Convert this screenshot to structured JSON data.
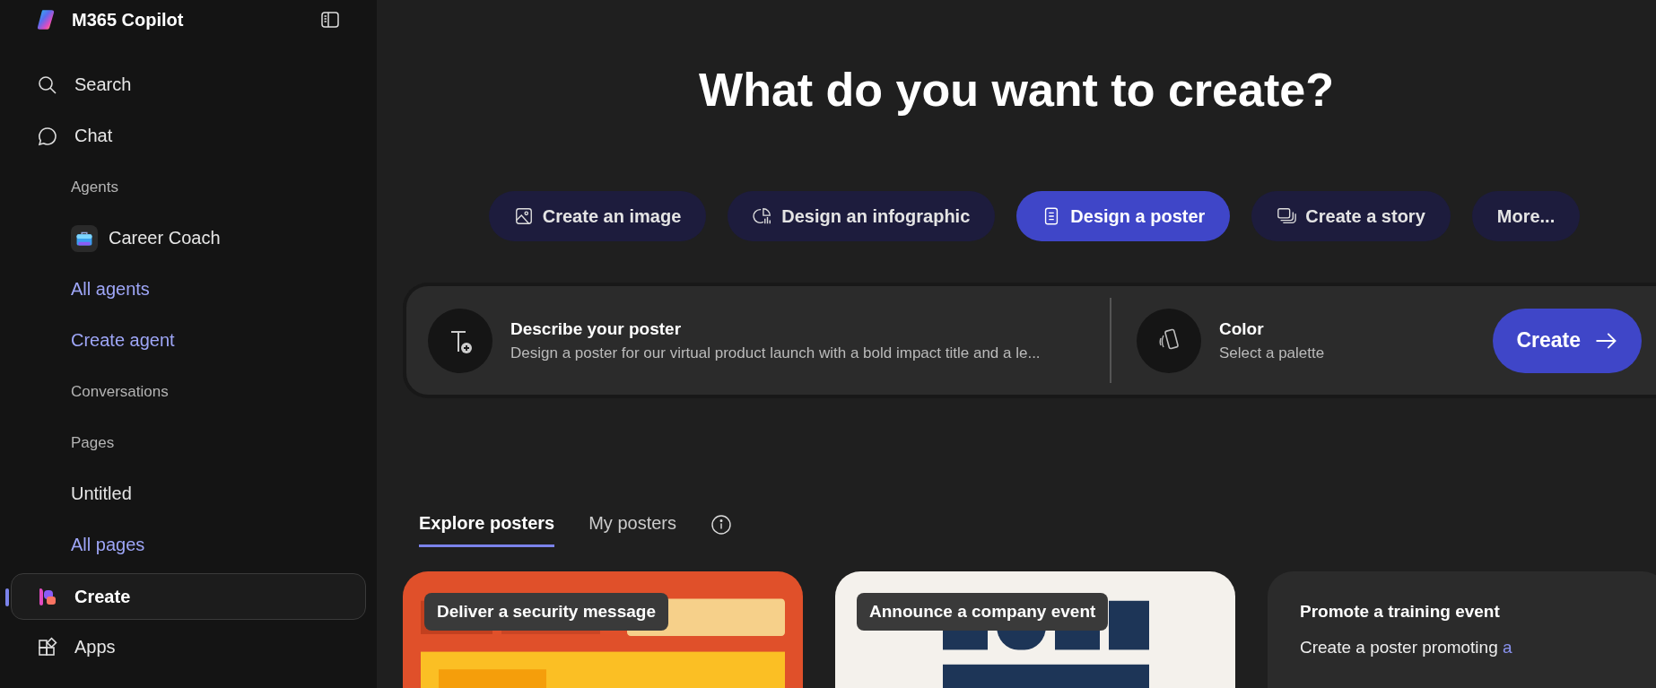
{
  "app": {
    "title": "M365 Copilot"
  },
  "sidebar": {
    "items": [
      {
        "kind": "nav",
        "label": "Search",
        "selected": false
      },
      {
        "kind": "nav",
        "label": "Chat",
        "selected": false
      },
      {
        "kind": "section",
        "label": "Agents"
      },
      {
        "kind": "agent",
        "label": "Career Coach",
        "selected": false
      },
      {
        "kind": "link",
        "label": "All agents"
      },
      {
        "kind": "link",
        "label": "Create agent"
      },
      {
        "kind": "section",
        "label": "Conversations"
      },
      {
        "kind": "section",
        "label": "Pages"
      },
      {
        "kind": "page",
        "label": "Untitled",
        "selected": false
      },
      {
        "kind": "link",
        "label": "All pages"
      },
      {
        "kind": "nav",
        "label": "Create",
        "selected": true
      },
      {
        "kind": "nav",
        "label": "Apps",
        "selected": false
      }
    ]
  },
  "main": {
    "heading": "What do you want to create?",
    "chips": [
      {
        "label": "Create an image",
        "selected": false
      },
      {
        "label": "Design an infographic",
        "selected": false
      },
      {
        "label": "Design a poster",
        "selected": true
      },
      {
        "label": "Create a story",
        "selected": false
      },
      {
        "label": "More...",
        "selected": false
      }
    ],
    "prompt": {
      "describe": {
        "title": "Describe your poster",
        "value": "Design a poster for our virtual product launch with a bold impact title and a le..."
      },
      "color": {
        "title": "Color",
        "value": "Select a palette"
      },
      "button": "Create"
    },
    "tabs": [
      {
        "label": "Explore posters",
        "selected": true
      },
      {
        "label": "My posters",
        "selected": false
      }
    ],
    "cards": [
      {
        "kind": "picture",
        "label": "Deliver a security message"
      },
      {
        "kind": "picture",
        "label": "Announce a company event"
      },
      {
        "kind": "text",
        "title": "Promote a training event",
        "description": "Create a poster promoting",
        "link": "a"
      }
    ]
  }
}
